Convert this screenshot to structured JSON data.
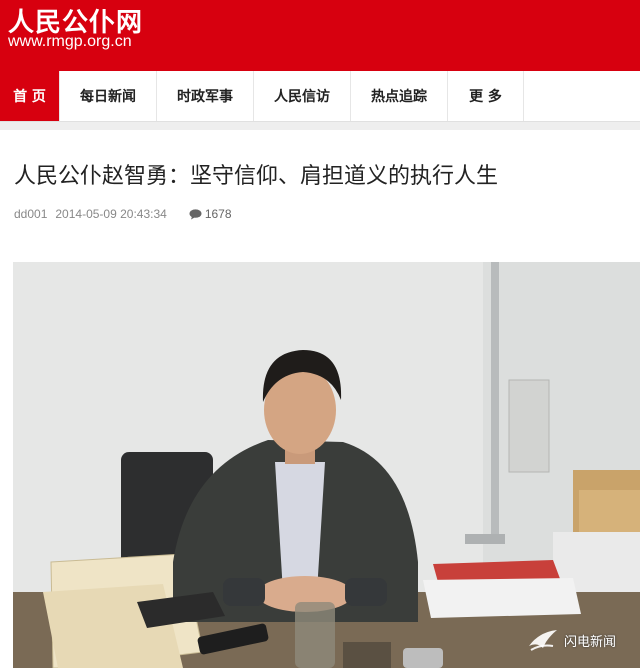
{
  "site": {
    "logo_text": "人民公仆网",
    "url_text": "www.rmgp.org.cn"
  },
  "nav": {
    "items": [
      {
        "label": "首 页"
      },
      {
        "label": "每日新闻"
      },
      {
        "label": "时政军事"
      },
      {
        "label": "人民信访"
      },
      {
        "label": "热点追踪"
      },
      {
        "label": "更 多"
      }
    ]
  },
  "article": {
    "title": "人民公仆赵智勇：坚守信仰、肩担道义的执行人生",
    "author": "dd001",
    "datetime": "2014-05-09 20:43:34",
    "comment_count": "1678"
  },
  "photo": {
    "watermark_text": "闪电新闻"
  },
  "colors": {
    "brand_red": "#d7000f"
  }
}
